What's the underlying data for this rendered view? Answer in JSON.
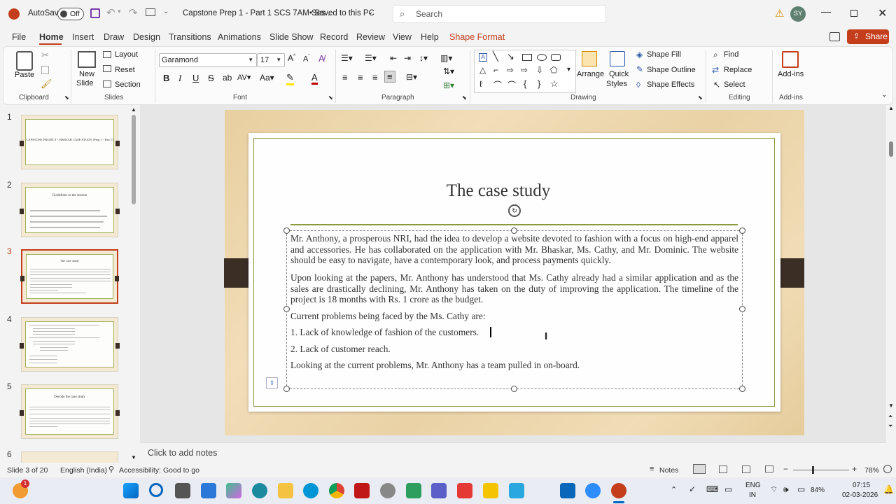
{
  "titlebar": {
    "autosave_label": "AutoSave",
    "autosave_state": "Off",
    "doc_title": "Capstone Prep 1 - Part 1 SCS 7AM Ses...",
    "save_status": "• Saved to this PC",
    "search_placeholder": "Search",
    "avatar_initials": "SY"
  },
  "tabs": [
    "File",
    "Home",
    "Insert",
    "Draw",
    "Design",
    "Transitions",
    "Animations",
    "Slide Show",
    "Record",
    "Review",
    "View",
    "Help",
    "Shape Format"
  ],
  "share_label": "Share",
  "ribbon": {
    "clipboard": {
      "paste": "Paste",
      "label": "Clipboard"
    },
    "slides": {
      "new_slide": "New",
      "new_slide2": "Slide",
      "layout": "Layout",
      "reset": "Reset",
      "section": "Section",
      "label": "Slides"
    },
    "font": {
      "font_name": "Garamond",
      "font_size": "17",
      "label": "Font"
    },
    "paragraph": {
      "label": "Paragraph"
    },
    "drawing": {
      "arrange": "Arrange",
      "quick": "Quick",
      "styles": "Styles",
      "shape_fill": "Shape Fill",
      "shape_outline": "Shape Outline",
      "shape_effects": "Shape Effects",
      "label": "Drawing"
    },
    "editing": {
      "find": "Find",
      "replace": "Replace",
      "select": "Select",
      "label": "Editing"
    },
    "addins": {
      "addins": "Add-ins",
      "label": "Add-ins"
    }
  },
  "thumbnails": [
    {
      "num": "1",
      "title": "CAPSTONE PROJECT - SIMILAR CASE STUDY (Prep 1 - Part 1)"
    },
    {
      "num": "2",
      "title": "Guidelines to the session"
    },
    {
      "num": "3",
      "title": "The case study"
    },
    {
      "num": "4",
      "title": ""
    },
    {
      "num": "5",
      "title": "Decode the case study"
    },
    {
      "num": "6",
      "title": ""
    }
  ],
  "slide": {
    "title": "The case study",
    "paragraphs": [
      "Mr. Anthony, a prosperous NRI, had the idea to develop a website devoted to fashion with a focus on high-end apparel and accessories. He has collaborated on the application with Mr. Bhaskar, Ms. Cathy, and Mr. Dominic. The website should be easy to navigate, have a contemporary look, and process payments quickly.",
      "Upon looking at the papers, Mr. Anthony has understood that Ms. Cathy already had a similar application and as the sales are drastically declining, Mr. Anthony has taken on the duty of improving the application. The timeline of the project is 18 months with Rs. 1 crore as the budget.",
      "Current problems being faced by the Ms. Cathy are:",
      "1. Lack of knowledge of fashion of the customers.",
      "2. Lack of customer reach.",
      "Looking at the current problems, Mr. Anthony has a team pulled in on-board."
    ]
  },
  "notes_placeholder": "Click to add notes",
  "status": {
    "slide_of": "Slide 3 of 20",
    "language": "English (India)",
    "accessibility": "Accessibility: Good to go",
    "notes": "Notes",
    "zoom": "78%"
  },
  "taskbar": {
    "lang1": "ENG",
    "lang2": "IN",
    "battery": "84%",
    "time": "07:15",
    "date": "02-03-2026",
    "notif": "1"
  }
}
